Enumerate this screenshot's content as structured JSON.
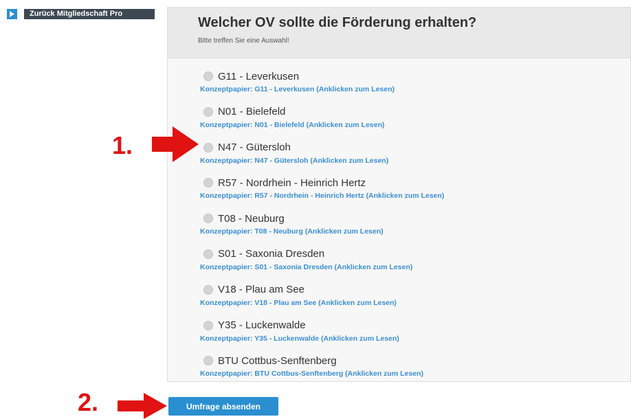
{
  "back_button": {
    "label": "Zurück Mitgliedschaft Pro",
    "icon": "play-triangle-icon"
  },
  "question": {
    "title": "Welcher OV sollte die Förderung erhalten?",
    "subtitle": "Bitte treffen Sie eine Auswahl!"
  },
  "options": [
    {
      "label": "G11 - Leverkusen",
      "link": "Konzeptpapier: G11 - Leverkusen (Anklicken zum Lesen)"
    },
    {
      "label": "N01 - Bielefeld",
      "link": "Konzeptpapier: N01 - Bielefeld (Anklicken zum Lesen)"
    },
    {
      "label": "N47 - Gütersloh",
      "link": "Konzeptpapier: N47 - Gütersloh (Anklicken zum Lesen)"
    },
    {
      "label": "R57 - Nordrhein - Heinrich Hertz",
      "link": "Konzeptpapier: R57 - Nordrhein - Heinrich Hertz (Anklicken zum Lesen)"
    },
    {
      "label": "T08 - Neuburg",
      "link": "Konzeptpapier: T08 - Neuburg (Anklicken zum Lesen)"
    },
    {
      "label": "S01 - Saxonia Dresden",
      "link": "Konzeptpapier: S01 - Saxonia Dresden (Anklicken zum Lesen)"
    },
    {
      "label": "V18 - Plau am See",
      "link": "Konzeptpapier: V18 - Plau am See (Anklicken zum Lesen)"
    },
    {
      "label": "Y35 - Luckenwalde",
      "link": "Konzeptpapier: Y35 - Luckenwalde (Anklicken zum Lesen)"
    },
    {
      "label": "BTU Cottbus-Senftenberg",
      "link": "Konzeptpapier: BTU Cottbus-Senftenberg (Anklicken zum Lesen)"
    }
  ],
  "annotations": {
    "step1": "1.",
    "step2": "2.",
    "color": "#e01212"
  },
  "submit": {
    "label": "Umfrage absenden"
  },
  "colors": {
    "accent": "#2a8fd0",
    "link": "#3b8fd6",
    "dark_bar": "#3d4852"
  }
}
